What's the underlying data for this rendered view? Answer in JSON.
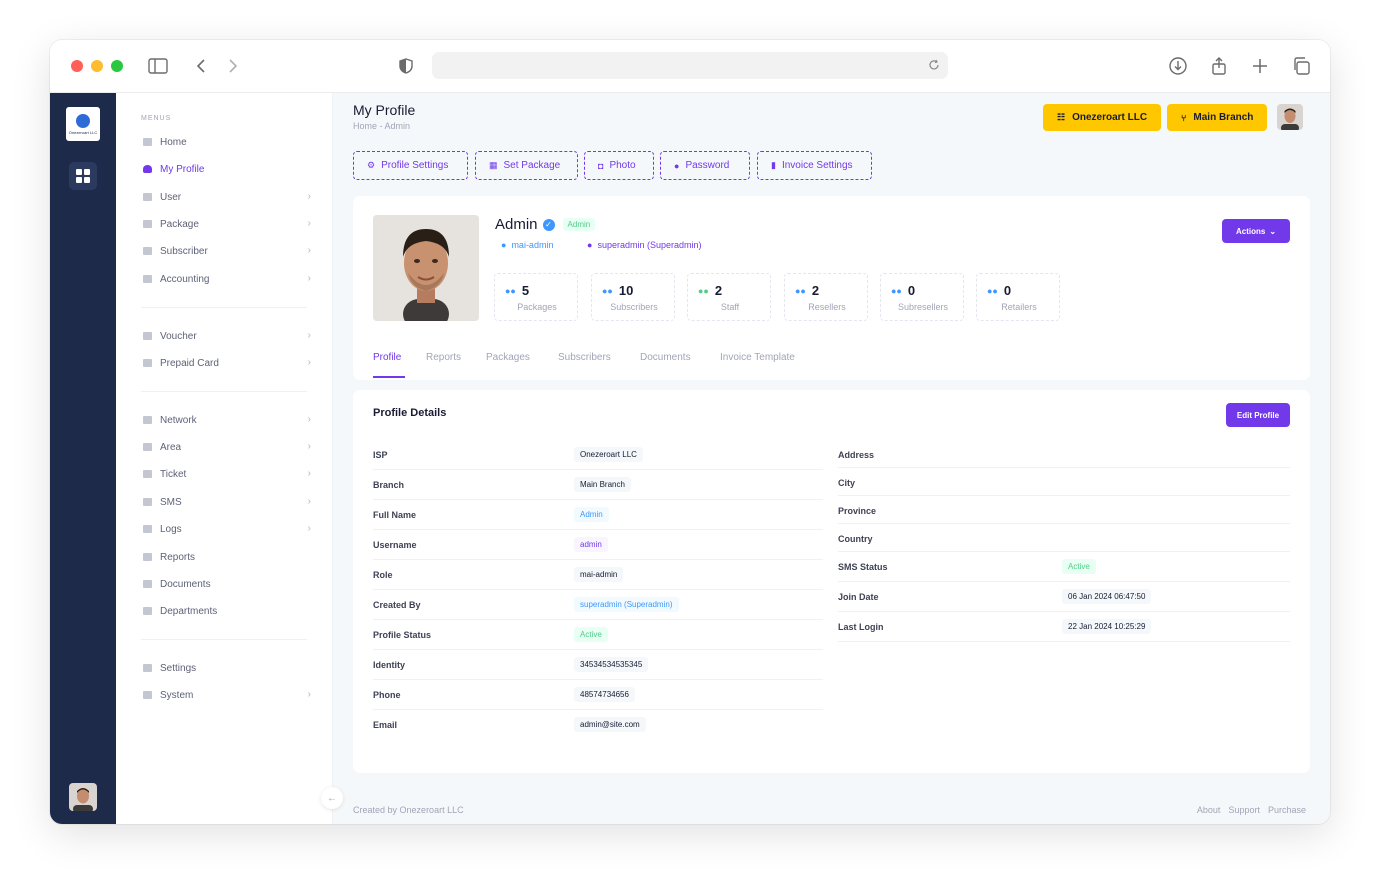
{
  "browser": {
    "url": ""
  },
  "rail": {
    "logo_text": "Onezeroart LLC"
  },
  "sidebar": {
    "menu_title": "MENUS",
    "items": [
      {
        "label": "Home",
        "icon": "home-icon"
      },
      {
        "label": "My Profile",
        "icon": "user-icon"
      },
      {
        "label": "User",
        "icon": "user-icon"
      },
      {
        "label": "Package",
        "icon": "package-icon"
      },
      {
        "label": "Subscriber",
        "icon": "users-icon"
      },
      {
        "label": "Accounting",
        "icon": "calculator-icon"
      },
      {
        "label": "Voucher",
        "icon": "voucher-icon"
      },
      {
        "label": "Prepaid Card",
        "icon": "card-icon"
      },
      {
        "label": "Network",
        "icon": "network-icon"
      },
      {
        "label": "Area",
        "icon": "area-icon"
      },
      {
        "label": "Ticket",
        "icon": "ticket-icon"
      },
      {
        "label": "SMS",
        "icon": "sms-icon"
      },
      {
        "label": "Logs",
        "icon": "logs-icon"
      },
      {
        "label": "Reports",
        "icon": "reports-icon"
      },
      {
        "label": "Documents",
        "icon": "documents-icon"
      },
      {
        "label": "Departments",
        "icon": "departments-icon"
      },
      {
        "label": "Settings",
        "icon": "settings-icon"
      },
      {
        "label": "System",
        "icon": "system-icon"
      }
    ]
  },
  "header": {
    "title": "My Profile",
    "breadcrumb": "Home  -  Admin",
    "company_button": "Onezeroart LLC",
    "branch_button": "Main Branch"
  },
  "tabs": [
    "Profile Settings",
    "Set Package",
    "Photo",
    "Password",
    "Invoice Settings"
  ],
  "profile": {
    "name": "Admin",
    "badge": "Admin",
    "username_link": "mai-admin",
    "created_by_link": "superadmin (Superadmin)",
    "actions_label": "Actions",
    "stats": [
      {
        "value": "5",
        "label": "Packages"
      },
      {
        "value": "10",
        "label": "Subscribers"
      },
      {
        "value": "2",
        "label": "Staff"
      },
      {
        "value": "2",
        "label": "Resellers"
      },
      {
        "value": "0",
        "label": "Subresellers"
      },
      {
        "value": "0",
        "label": "Retailers"
      }
    ],
    "profile_tabs": [
      "Profile",
      "Reports",
      "Packages",
      "Subscribers",
      "Documents",
      "Invoice Template"
    ]
  },
  "details": {
    "title": "Profile Details",
    "edit_label": "Edit Profile",
    "left": [
      {
        "key": "ISP",
        "value": "Onezeroart LLC"
      },
      {
        "key": "Branch",
        "value": "Main Branch"
      },
      {
        "key": "Full Name",
        "value": "Admin"
      },
      {
        "key": "Username",
        "value": "admin"
      },
      {
        "key": "Role",
        "value": "mai-admin"
      },
      {
        "key": "Created By",
        "value": "superadmin (Superadmin)"
      },
      {
        "key": "Profile Status",
        "value": "Active"
      },
      {
        "key": "Identity",
        "value": "34534534535345"
      },
      {
        "key": "Phone",
        "value": "48574734656"
      },
      {
        "key": "Email",
        "value": "admin@site.com"
      }
    ],
    "right": [
      {
        "key": "Address",
        "value": ""
      },
      {
        "key": "City",
        "value": ""
      },
      {
        "key": "Province",
        "value": ""
      },
      {
        "key": "Country",
        "value": ""
      },
      {
        "key": "SMS Status",
        "value": "Active"
      },
      {
        "key": "Join Date",
        "value": "06 Jan 2024 06:47:50"
      },
      {
        "key": "Last Login",
        "value": "22 Jan 2024 10:25:29"
      }
    ]
  },
  "footer": {
    "created_by": "Created by",
    "brand": "Onezeroart LLC",
    "links": [
      "About",
      "Support",
      "Purchase"
    ]
  },
  "colors": {
    "accent": "#7239ea",
    "warning": "#ffc700",
    "rail": "#1e2a4a",
    "success": "#50cd89",
    "info": "#3e97ff"
  }
}
